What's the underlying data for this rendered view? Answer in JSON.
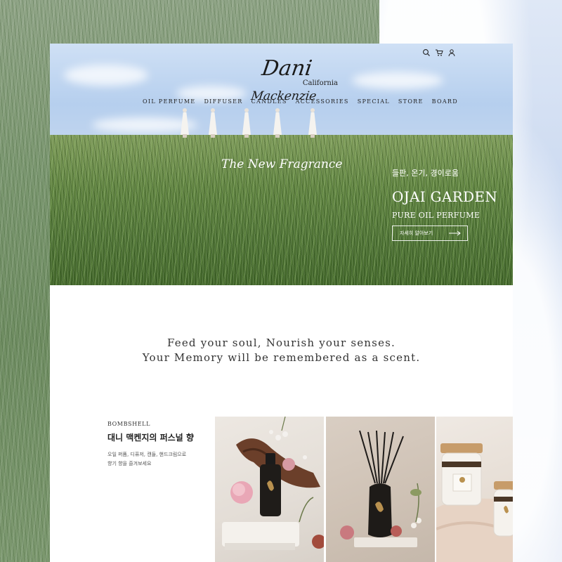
{
  "brand": {
    "name_first": "Dani",
    "name_last": "Mackenzie",
    "location": "California"
  },
  "header_icons": [
    "search-icon",
    "cart-icon",
    "user-icon"
  ],
  "nav": {
    "items": [
      "OIL PERFUME",
      "DIFFUSER",
      "CANDLES",
      "ACCESSORIES",
      "SPECIAL",
      "STORE",
      "BOARD"
    ]
  },
  "hero": {
    "tagline": "The New Fragrance",
    "kr_line": "들판, 온기, 경이로움",
    "title": "OJAI GARDEN",
    "subtitle": "PURE OIL PERFUME",
    "cta_label": "자세히 알아보기"
  },
  "slogan": {
    "line1": "Feed your soul, Nourish your senses.",
    "line2": "Your Memory will be remembered as a scent."
  },
  "intro": {
    "label": "BOMBSHELL",
    "heading": "대니 맥켄지의 퍼스널 향",
    "desc_line1": "오일 퍼퓸, 디퓨저, 캔들, 핸드크림으로",
    "desc_line2": "향기 향을 즐겨보세요"
  },
  "colors": {
    "text_dark": "#222222",
    "hero_text": "#ffffff"
  }
}
